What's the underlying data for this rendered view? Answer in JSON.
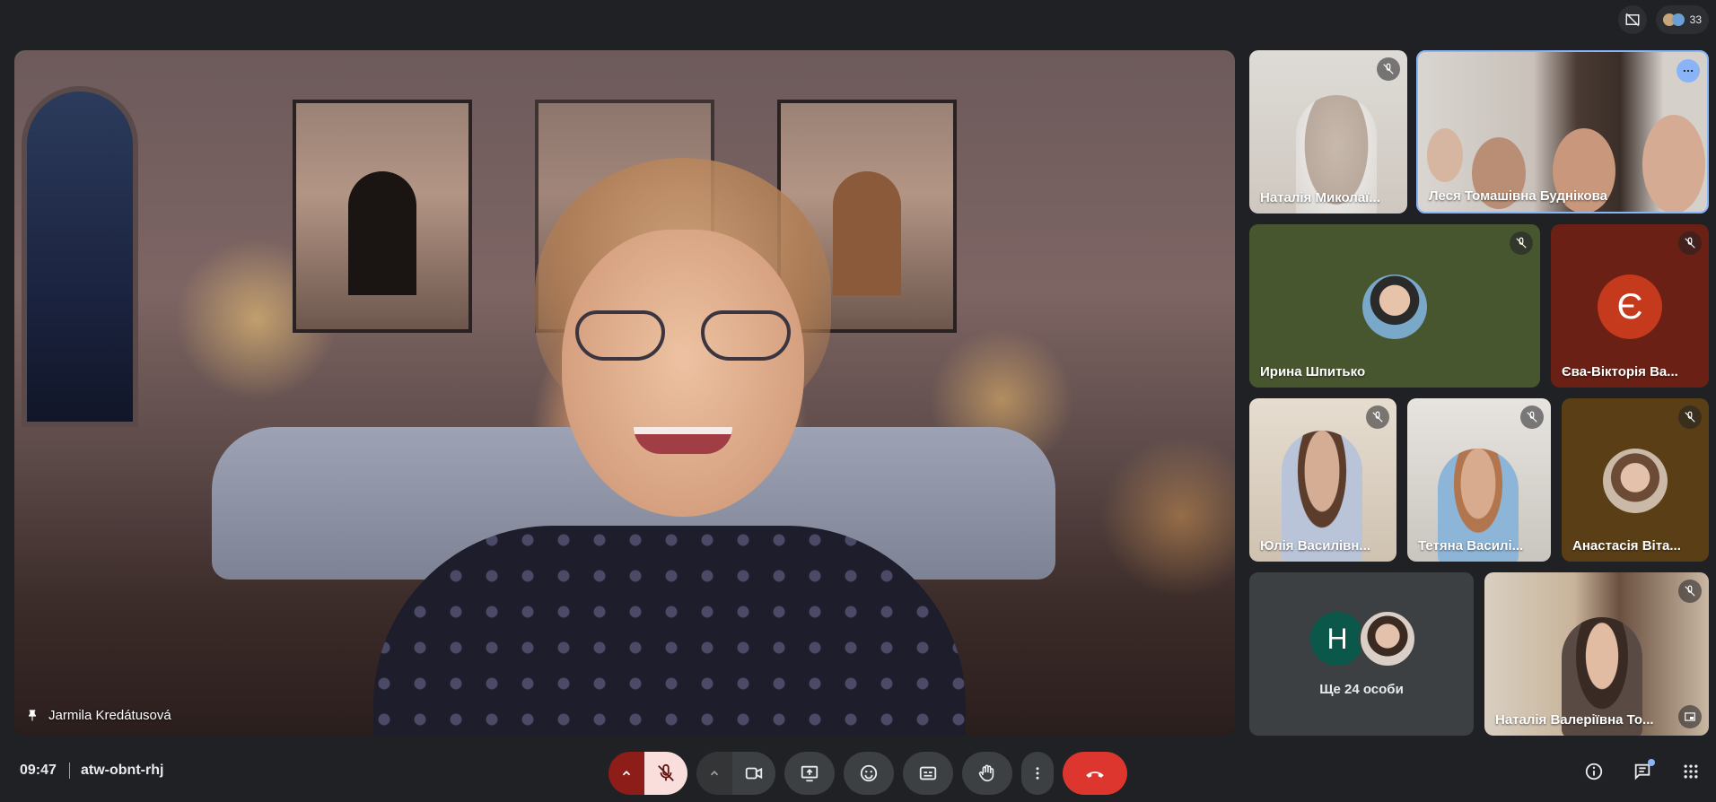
{
  "top": {
    "participant_count": "33"
  },
  "main": {
    "speaker_name": "Jarmila Kredátusová"
  },
  "tiles": [
    {
      "name": "Наталія Миколаї...",
      "muted": true
    },
    {
      "name": "Леся Томашівна Буднікова",
      "muted": false,
      "active": true
    },
    {
      "name": "Ирина Шпитько",
      "muted": true
    },
    {
      "name": "Єва-Вікторія Ва...",
      "muted": true,
      "letter": "Є",
      "color": "#c5391c"
    },
    {
      "name": "Юлія Василівн...",
      "muted": true
    },
    {
      "name": "Тетяна Василі...",
      "muted": true
    },
    {
      "name": "Анастасія Віта...",
      "muted": true
    },
    {
      "name": "Наталія Валеріївна То...",
      "muted": true
    }
  ],
  "others": {
    "label": "Ще 24 особи",
    "letter": "Н",
    "letter_color": "#0b5749"
  },
  "bottom": {
    "time": "09:47",
    "meeting_code": "atw-obnt-rhj"
  },
  "colors": {
    "background": "#202124",
    "mic_off": "#f9dedc",
    "mic_chevron": "#8c1d18",
    "end_call": "#dc362e",
    "active_border": "#8ab4f8"
  }
}
